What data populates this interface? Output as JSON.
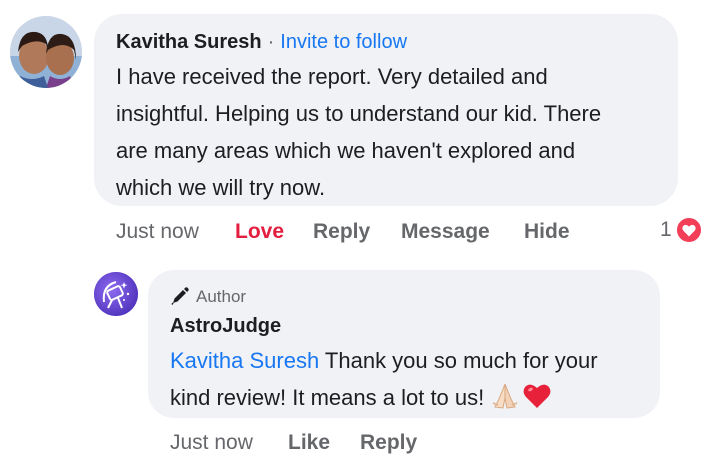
{
  "comment": {
    "author": "Kavitha Suresh",
    "separator": "·",
    "follow_link": "Invite to follow",
    "text_lines": [
      "I have received the report. Very detailed and",
      "insightful. Helping us to understand our kid. There",
      "are many areas which we haven't explored and",
      "which we will try now."
    ],
    "actions": {
      "time": "Just now",
      "love": "Love",
      "reply": "Reply",
      "message": "Message",
      "hide": "Hide"
    },
    "reaction_count": "1",
    "reaction_icon": "heart-icon"
  },
  "reply": {
    "badge": "Author",
    "badge_icon": "pen-icon",
    "author": "AstroJudge",
    "mention": "Kavitha Suresh",
    "text_line1": " Thank you so much for your",
    "text_line2": "kind review! It means a lot to us! ",
    "emojis": [
      "folded-hands-emoji",
      "red-heart-emoji"
    ],
    "actions": {
      "time": "Just now",
      "like": "Like",
      "reply": "Reply"
    }
  },
  "colors": {
    "bubble": "#f0f2f5",
    "link": "#1877f2",
    "love": "#e41e3f",
    "meta": "#65676b"
  }
}
